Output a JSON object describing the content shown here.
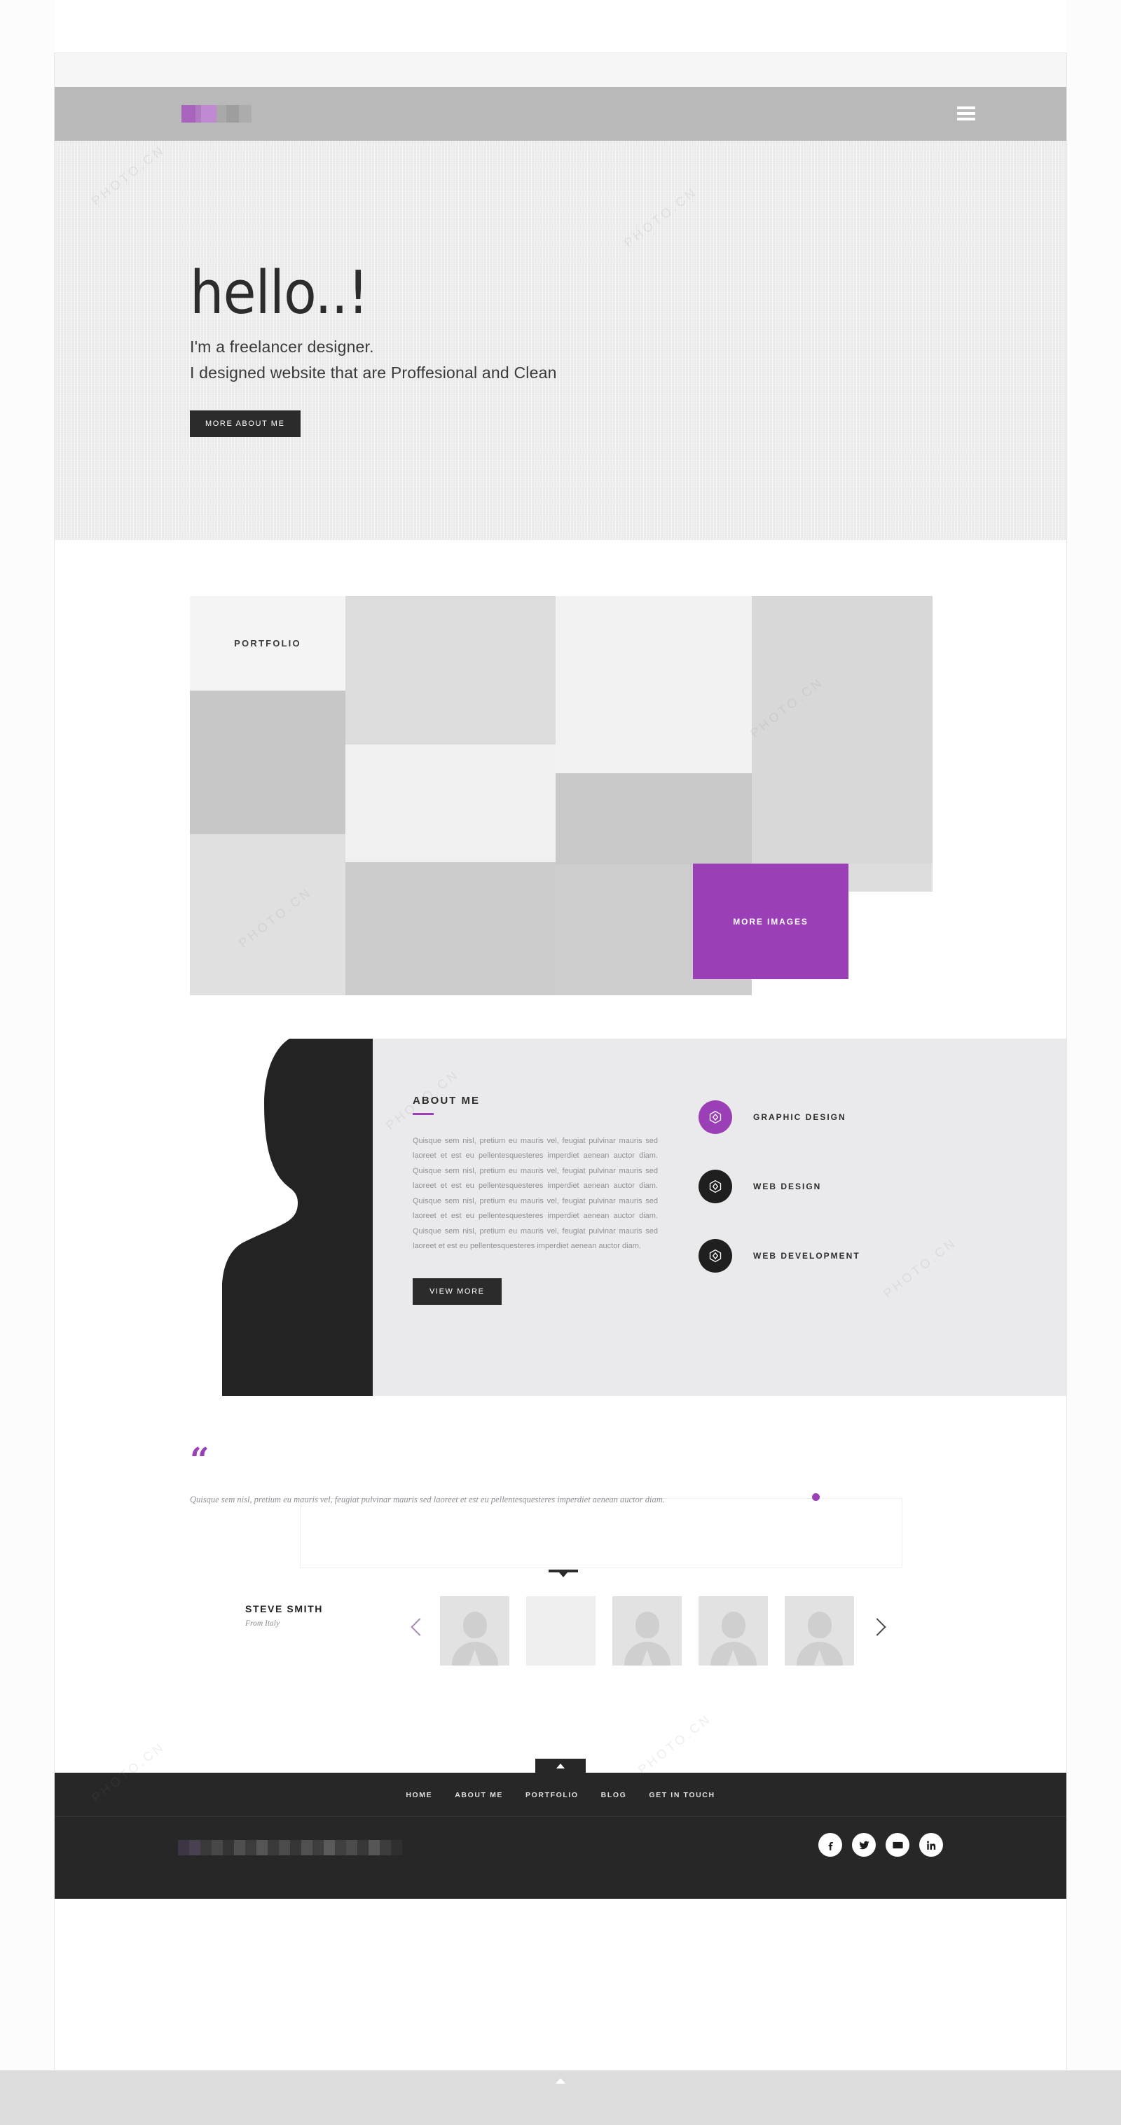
{
  "header": {
    "logo_alt": "pixelated-logo",
    "menu_icon": "hamburger-icon"
  },
  "hero": {
    "title": "hello..!",
    "subtitle_line1": "I'm a freelancer designer.",
    "subtitle_line2": "I designed website that are Proffesional and Clean",
    "cta_label": "MORE ABOUT ME"
  },
  "portfolio": {
    "label": "PORTFOLIO",
    "more_label": "MORE IMAGES",
    "accent_color": "#9b3fb7",
    "tiles": [
      {
        "name": "tile-a",
        "color": "#c7c7c7"
      },
      {
        "name": "tile-b",
        "color": "#e0e0e0"
      },
      {
        "name": "tile-c",
        "color": "#dcdcdc"
      },
      {
        "name": "tile-d",
        "color": "#f0f0f0"
      },
      {
        "name": "tile-e",
        "color": "#cccccc"
      },
      {
        "name": "tile-f",
        "color": "#f2f2f2"
      },
      {
        "name": "tile-g",
        "color": "#c8c8c8"
      },
      {
        "name": "tile-h",
        "color": "#cdcdcd"
      },
      {
        "name": "tile-i",
        "color": "#d8d8d8"
      },
      {
        "name": "tile-j",
        "color": "#dddddd"
      }
    ]
  },
  "about": {
    "heading": "ABOUT ME",
    "body": "Quisque sem nisl, pretium eu mauris vel, feugiat pulvinar mauris sed laoreet et est eu pellentesquesteres imperdiet aenean auctor diam. Quisque sem nisl, pretium eu mauris vel, feugiat pulvinar mauris sed laoreet et est eu pellentesquesteres imperdiet aenean auctor diam. Quisque sem nisl, pretium eu mauris vel, feugiat pulvinar mauris sed laoreet et est eu pellentesquesteres imperdiet aenean auctor diam. Quisque sem nisl, pretium eu mauris vel, feugiat pulvinar mauris sed laoreet et est eu pellentesquesteres imperdiet aenean auctor diam.",
    "cta_label": "VIEW MORE",
    "services": [
      {
        "label": "GRAPHIC DESIGN",
        "icon": "cube-icon",
        "bubble": "#9b3fb7"
      },
      {
        "label": "WEB DESIGN",
        "icon": "cube-icon",
        "bubble": "#1f1f1f"
      },
      {
        "label": "WEB DEVELOPMENT",
        "icon": "cube-icon",
        "bubble": "#1f1f1f"
      }
    ]
  },
  "testimonial": {
    "quote_mark": "“",
    "quote": "Quisque sem nisl, pretium eu mauris vel, feugiat pulvinar mauris sed laoreet et est eu pellentesquesteres imperdiet aenean auctor diam.",
    "author_name": "STEVE SMITH",
    "author_from": "From Italy",
    "prev_icon": "chevron-left-icon",
    "next_icon": "chevron-right-icon",
    "thumbnails": [
      {
        "name": "thumb-1",
        "state": "avatar"
      },
      {
        "name": "thumb-2",
        "state": "empty"
      },
      {
        "name": "thumb-3",
        "state": "avatar"
      },
      {
        "name": "thumb-4",
        "state": "avatar"
      },
      {
        "name": "thumb-5",
        "state": "avatar"
      }
    ]
  },
  "footer": {
    "nav": [
      {
        "label": "HOME"
      },
      {
        "label": "ABOUT ME"
      },
      {
        "label": "PORTFOLIO"
      },
      {
        "label": "BLOG"
      },
      {
        "label": "GET IN TOUCH"
      }
    ],
    "social": [
      {
        "name": "facebook-icon"
      },
      {
        "name": "twitter-icon"
      },
      {
        "name": "email-icon"
      },
      {
        "name": "linkedin-icon"
      }
    ],
    "copyright_alt": "blurred-copyright-text",
    "scroll_top_icon": "chevron-up-icon",
    "background": "#272727"
  },
  "watermark": {
    "text": "PHOTO.CN"
  }
}
